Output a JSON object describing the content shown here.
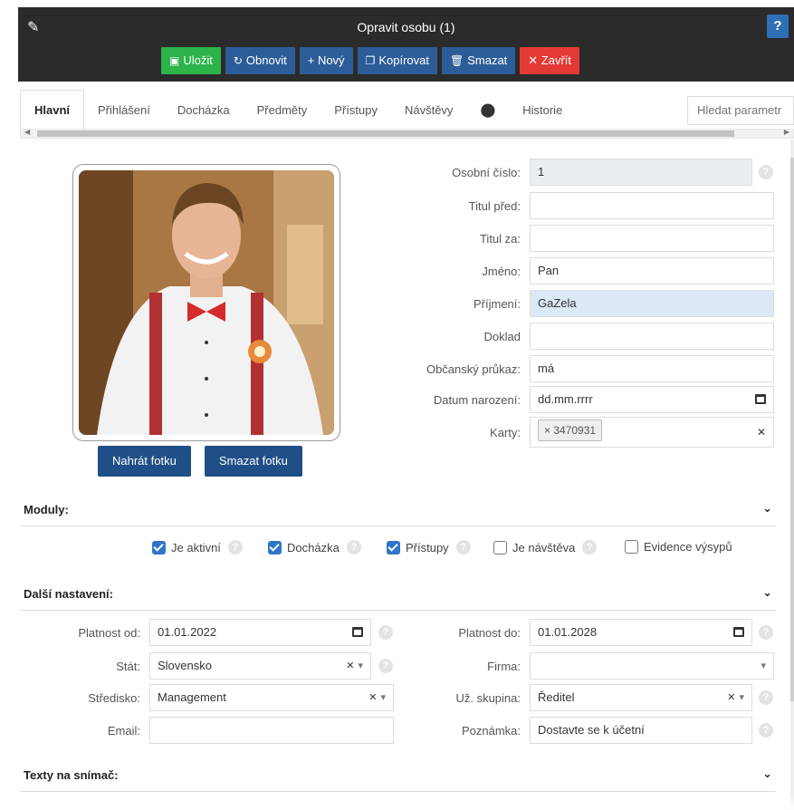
{
  "window": {
    "title": "Opravit osobu (1)",
    "help": "?"
  },
  "toolbar": {
    "save": "Uložit",
    "refresh": "Obnovit",
    "new": "+ Nový",
    "copy": "Kopírovat",
    "delete": "Smazat",
    "close": "✕ Zavřít"
  },
  "tabs": [
    "Hlavní",
    "Přihlášení",
    "Docházka",
    "Předměty",
    "Přístupy",
    "Návštěvy",
    "Historie"
  ],
  "tab_search": {
    "placeholder": "Hledat parametr"
  },
  "photo": {
    "upload": "Nahrát fotku",
    "delete": "Smazat fotku"
  },
  "person": {
    "labels": {
      "id": "Osobní číslo:",
      "title_before": "Titul před:",
      "title_after": "Titul za:",
      "first_name": "Jméno:",
      "last_name": "Příjmení:",
      "document": "Doklad",
      "id_card": "Občanský průkaz:",
      "birth": "Datum narození:",
      "cards": "Karty:"
    },
    "values": {
      "id": "1",
      "title_before": "",
      "title_after": "",
      "first_name": "Pan",
      "last_name": "GaZela",
      "document": "",
      "id_card": "má",
      "birth": "dd.mm.rrrr",
      "card": "× 3470931"
    }
  },
  "modules": {
    "title": "Moduly:",
    "items": [
      {
        "label": "Je aktivní",
        "checked": true
      },
      {
        "label": "Docházka",
        "checked": true
      },
      {
        "label": "Přístupy",
        "checked": true
      },
      {
        "label": "Je návštěva",
        "checked": false
      },
      {
        "label": "Evidence výsypů",
        "checked": false
      }
    ]
  },
  "settings": {
    "title": "Další nastavení:",
    "labels": {
      "valid_from": "Platnost od:",
      "valid_to": "Platnost do:",
      "state": "Stát:",
      "company": "Firma:",
      "center": "Středisko:",
      "group": "Už. skupina:",
      "email": "Email:",
      "note": "Poznámka:"
    },
    "values": {
      "valid_from": "01.01.2022",
      "valid_to": "01.01.2028",
      "state": "Slovensko",
      "company": "",
      "center": "Management",
      "group": "Ředitel",
      "email": "",
      "note": "Dostavte se k účetní"
    }
  },
  "texts": {
    "title": "Texty na snímač:"
  }
}
